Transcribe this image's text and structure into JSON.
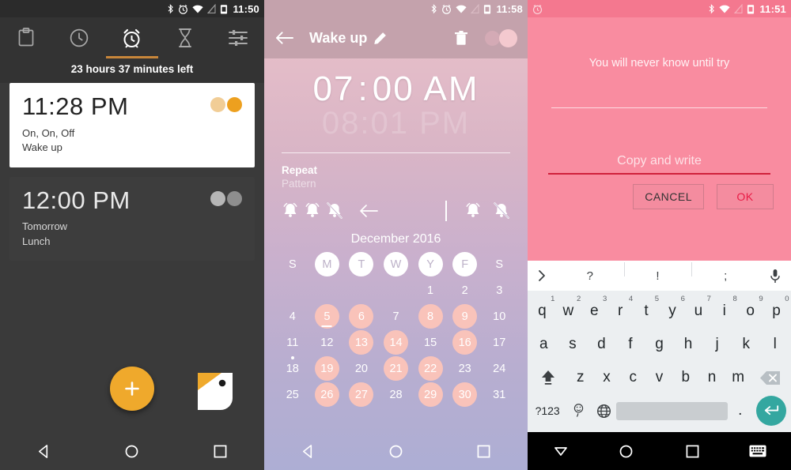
{
  "panel1": {
    "statusbar": {
      "icons": [
        "bluetooth-icon",
        "alarm-icon",
        "wifi-icon",
        "signal-off-icon",
        "battery-icon"
      ],
      "time": "11:50"
    },
    "tabs": [
      {
        "name": "clipboard",
        "icon": "clipboard-icon",
        "active": false
      },
      {
        "name": "clock",
        "icon": "clock-icon",
        "active": false
      },
      {
        "name": "alarm",
        "icon": "alarm-clock-icon",
        "active": true
      },
      {
        "name": "timer",
        "icon": "hourglass-icon",
        "active": false
      },
      {
        "name": "settings",
        "icon": "sliders-icon",
        "active": false
      }
    ],
    "countdown": "23 hours 37 minutes  left",
    "alarms": [
      {
        "time": "11:28 PM",
        "repeat": "On, On, Off",
        "label": "Wake up",
        "enabled": true
      },
      {
        "time": "12:00 PM",
        "repeat": "Tomorrow",
        "label": "Lunch",
        "enabled": false
      }
    ],
    "fab": {
      "icon": "plus-icon",
      "label": "Add alarm"
    },
    "app_logo": "bird-logo-icon",
    "nav": [
      "back-icon",
      "home-icon",
      "recents-icon"
    ],
    "colors": {
      "accent": "#efa92c",
      "background": "#3a3a3a",
      "card_on": "#ffffff",
      "card_off": "#3d3d3d"
    }
  },
  "panel2": {
    "statusbar": {
      "icons": [
        "bluetooth-icon",
        "alarm-icon",
        "wifi-icon",
        "signal-off-icon",
        "battery-icon"
      ],
      "time": "11:58"
    },
    "appbar": {
      "back": "back-arrow-icon",
      "title": "Wake up",
      "edit": "pencil-icon",
      "delete": "trash-icon",
      "toggle_on": true
    },
    "time": {
      "hour": "07",
      "colon": ":",
      "minute": "00",
      "meridiem": "AM"
    },
    "ghost_time": {
      "hour": "08",
      "colon": ":",
      "minute": "01",
      "meridiem": "PM"
    },
    "repeat": {
      "title": "Repeat",
      "subtitle": "Pattern"
    },
    "pattern_icons": [
      "bell-on-icon",
      "bell-on-icon",
      "bell-off-icon",
      "back-arrow-icon"
    ],
    "pattern_tools": [
      "bell-on-icon",
      "bell-off-icon"
    ],
    "calendar": {
      "month": "December 2016",
      "weekdays": [
        {
          "label": "S",
          "highlight": false
        },
        {
          "label": "M",
          "highlight": true
        },
        {
          "label": "T",
          "highlight": true
        },
        {
          "label": "W",
          "highlight": true
        },
        {
          "label": "Y",
          "highlight": true
        },
        {
          "label": "F",
          "highlight": true
        },
        {
          "label": "S",
          "highlight": false
        }
      ],
      "weeks": [
        [
          {
            "d": "",
            "s": "empty"
          },
          {
            "d": "",
            "s": "empty"
          },
          {
            "d": "",
            "s": "empty"
          },
          {
            "d": "",
            "s": "empty"
          },
          {
            "d": "1",
            "s": "plain"
          },
          {
            "d": "2",
            "s": "plain"
          },
          {
            "d": "3",
            "s": "plain"
          }
        ],
        [
          {
            "d": "4",
            "s": "plain"
          },
          {
            "d": "5",
            "s": "peach-underline"
          },
          {
            "d": "6",
            "s": "peach"
          },
          {
            "d": "7",
            "s": "plain"
          },
          {
            "d": "8",
            "s": "peach"
          },
          {
            "d": "9",
            "s": "peach"
          },
          {
            "d": "10",
            "s": "plain"
          }
        ],
        [
          {
            "d": "11",
            "s": "plain"
          },
          {
            "d": "12",
            "s": "plain"
          },
          {
            "d": "13",
            "s": "peach"
          },
          {
            "d": "14",
            "s": "peach"
          },
          {
            "d": "15",
            "s": "plain"
          },
          {
            "d": "16",
            "s": "peach"
          },
          {
            "d": "17",
            "s": "plain"
          }
        ],
        [
          {
            "d": "18",
            "s": "plain-dot"
          },
          {
            "d": "19",
            "s": "peach"
          },
          {
            "d": "20",
            "s": "plain"
          },
          {
            "d": "21",
            "s": "peach"
          },
          {
            "d": "22",
            "s": "peach"
          },
          {
            "d": "23",
            "s": "plain"
          },
          {
            "d": "24",
            "s": "plain"
          }
        ],
        [
          {
            "d": "25",
            "s": "plain"
          },
          {
            "d": "26",
            "s": "peach"
          },
          {
            "d": "27",
            "s": "peach"
          },
          {
            "d": "28",
            "s": "plain"
          },
          {
            "d": "29",
            "s": "peach"
          },
          {
            "d": "30",
            "s": "peach"
          },
          {
            "d": "31",
            "s": "plain"
          }
        ]
      ]
    },
    "nav": [
      "back-icon",
      "home-icon",
      "recents-icon"
    ],
    "colors": {
      "chip_selected": "#f9c3ba",
      "appbar": "#c4a2ac",
      "gradient_top": "#e8c3cc",
      "gradient_bottom": "#adaed4"
    }
  },
  "panel3": {
    "statusbar": {
      "left_icons": [
        "alarm-notification-icon"
      ],
      "icons": [
        "bluetooth-icon",
        "wifi-icon",
        "signal-off-icon",
        "battery-icon"
      ],
      "time": "11:51"
    },
    "message": "You will never know until try",
    "input": {
      "value": "",
      "placeholder": "Copy and write"
    },
    "buttons": {
      "cancel": "CANCEL",
      "ok": "OK"
    },
    "keyboard": {
      "suggestions": [
        "?",
        "!",
        ";"
      ],
      "expand_icon": "chevron-right-icon",
      "mic_icon": "microphone-icon",
      "row1": [
        {
          "k": "q",
          "n": "1"
        },
        {
          "k": "w",
          "n": "2"
        },
        {
          "k": "e",
          "n": "3"
        },
        {
          "k": "r",
          "n": "4"
        },
        {
          "k": "t",
          "n": "5"
        },
        {
          "k": "y",
          "n": "6"
        },
        {
          "k": "u",
          "n": "7"
        },
        {
          "k": "i",
          "n": "8"
        },
        {
          "k": "o",
          "n": "9"
        },
        {
          "k": "p",
          "n": "0"
        }
      ],
      "row2": [
        "a",
        "s",
        "d",
        "f",
        "g",
        "h",
        "j",
        "k",
        "l"
      ],
      "row3": [
        "z",
        "x",
        "c",
        "v",
        "b",
        "n",
        "m"
      ],
      "shift_icon": "shift-icon",
      "backspace_icon": "backspace-icon",
      "symbols_key": "?123",
      "emoji_key": "emoji-icon",
      "globe_key": "globe-icon",
      "period_key": ".",
      "enter_icon": "enter-icon"
    },
    "nav": [
      "keyboard-hide-icon",
      "home-icon",
      "recents-icon",
      "keyboard-switch-icon"
    ],
    "colors": {
      "background": "#f98ca0",
      "underline": "#d0203c",
      "ok_text": "#e81b45",
      "enter": "#34a7a0"
    }
  }
}
